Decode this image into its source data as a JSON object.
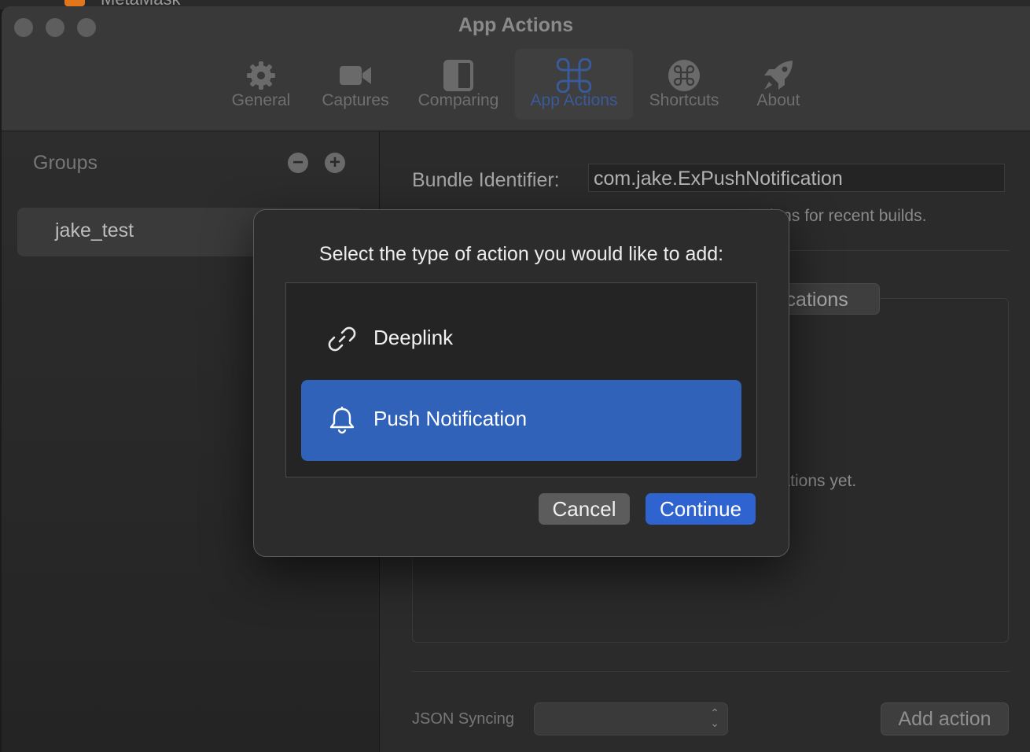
{
  "background_app": {
    "label": "MetaMask"
  },
  "window": {
    "title": "App Actions"
  },
  "toolbar": {
    "items": [
      {
        "label": "General",
        "icon": "gear-icon"
      },
      {
        "label": "Captures",
        "icon": "video-camera-icon"
      },
      {
        "label": "Comparing",
        "icon": "split-view-icon"
      },
      {
        "label": "App Actions",
        "icon": "command-icon",
        "active": true
      },
      {
        "label": "Shortcuts",
        "icon": "command-circle-icon"
      },
      {
        "label": "About",
        "icon": "rocket-icon"
      }
    ]
  },
  "sidebar": {
    "title": "Groups",
    "remove_label": "−",
    "add_label": "+",
    "groups": [
      {
        "label": "jake_test",
        "selected": true
      }
    ]
  },
  "main": {
    "bundle_label": "Bundle Identifier:",
    "bundle_value": "com.jake.ExPushNotification",
    "bundle_hint": "tions for recent builds.",
    "segment_visible": "ications",
    "empty_text": "cations yet.",
    "json_label": "JSON Syncing",
    "json_value": "",
    "add_action_label": "Add action"
  },
  "dialog": {
    "title": "Select the type of action you would like to add:",
    "options": [
      {
        "label": "Deeplink",
        "icon": "link-icon",
        "selected": false
      },
      {
        "label": "Push Notification",
        "icon": "bell-icon",
        "selected": true
      }
    ],
    "cancel_label": "Cancel",
    "continue_label": "Continue"
  },
  "colors": {
    "accent": "#2f63cf",
    "selection": "#2f62b8",
    "window_bg": "#2c2c2c"
  }
}
